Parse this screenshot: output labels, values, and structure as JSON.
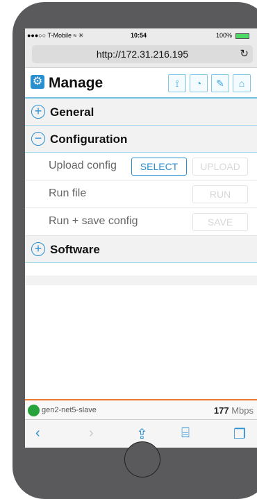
{
  "status": {
    "carrier": "●●●○○ T-Mobile ≈ ✳",
    "time": "10:54",
    "battery": "100%"
  },
  "browser": {
    "url": "http://172.31.216.195",
    "reload_icon": "reload-icon"
  },
  "header": {
    "title": "Manage",
    "icons": [
      "wifi-icon",
      "gauge-icon",
      "wrench-icon",
      "home-icon"
    ]
  },
  "sections": [
    {
      "label": "General",
      "state": "+"
    },
    {
      "label": "Configuration",
      "state": "−"
    },
    {
      "label": "Software",
      "state": "+"
    }
  ],
  "config_rows": [
    {
      "label": "Upload config",
      "select": "SELECT",
      "action": "UPLOAD"
    },
    {
      "label": "Run file",
      "action": "RUN"
    },
    {
      "label": "Run + save config",
      "action": "SAVE"
    }
  ],
  "footer": {
    "host": "gen2-net5-slave",
    "speed_value": "177",
    "speed_unit": "Mbps"
  },
  "safari_toolbar": {
    "back": "‹",
    "forward": "›"
  }
}
